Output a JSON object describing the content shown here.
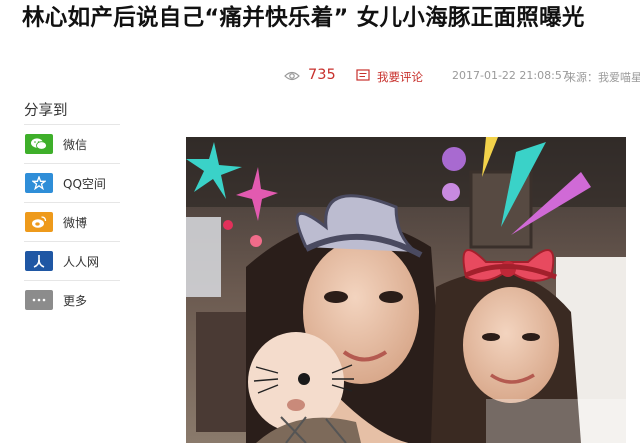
{
  "article": {
    "title": "林心如产后说自己“痛并快乐着” 女儿小海豚正面照曝光",
    "views": "735",
    "comment_label": "我要评论",
    "date": "2017-01-22 21:08:57",
    "source": "来源：我爱喵星人"
  },
  "share": {
    "title": "分享到",
    "items": [
      {
        "label": "微信",
        "icon": "wechat-icon",
        "color": "#3eaf2a"
      },
      {
        "label": "QQ空间",
        "icon": "qzone-star-icon",
        "color": "#2f8ed8"
      },
      {
        "label": "微博",
        "icon": "weibo-icon",
        "color": "#ee9a1b"
      },
      {
        "label": "人人网",
        "icon": "renren-icon",
        "color": "#1f57a4"
      },
      {
        "label": "更多",
        "icon": "more-dots-icon",
        "color": "#8c8c8c"
      }
    ]
  },
  "colors": {
    "accent_red": "#c8312d",
    "meta_grey": "#9a9a9a"
  }
}
